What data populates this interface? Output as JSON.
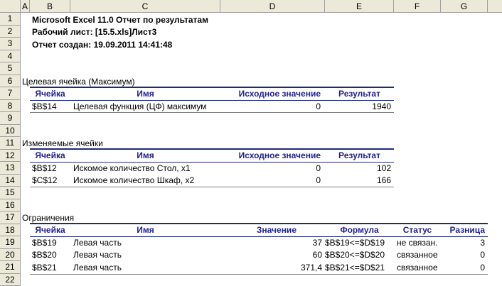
{
  "columns": [
    "A",
    "B",
    "C",
    "D",
    "E",
    "F",
    "G"
  ],
  "rows": [
    "1",
    "2",
    "3",
    "4",
    "5",
    "6",
    "7",
    "8",
    "9",
    "10",
    "11",
    "12",
    "13",
    "14",
    "15",
    "16",
    "17",
    "18",
    "19",
    "20",
    "21",
    "22"
  ],
  "report": {
    "title": "Microsoft Excel 11.0 Отчет по результатам",
    "worksheet": "Рабочий лист: [15.5.xls]Лист3",
    "created": "Отчет создан: 19.09.2011 14:41:48"
  },
  "target": {
    "section": "Целевая ячейка (Максимум)",
    "headers": [
      "Ячейка",
      "Имя",
      "Исходное значение",
      "Результат"
    ],
    "rows": [
      {
        "cell": "$B$14",
        "name": "Целевая функция (ЦФ) максимум",
        "initial": "0",
        "result": "1940"
      }
    ]
  },
  "variables": {
    "section": "Изменяемые ячейки",
    "headers": [
      "Ячейка",
      "Имя",
      "Исходное значение",
      "Результат"
    ],
    "rows": [
      {
        "cell": "$B$12",
        "name": "Искомое количество Стол, х1",
        "initial": "0",
        "result": "102"
      },
      {
        "cell": "$C$12",
        "name": "Искомое количество Шкаф, х2",
        "initial": "0",
        "result": "166"
      }
    ]
  },
  "constraints": {
    "section": "Ограничения",
    "headers": [
      "Ячейка",
      "Имя",
      "Значение",
      "Формула",
      "Статус",
      "Разница"
    ],
    "rows": [
      {
        "cell": "$B$19",
        "name": "Левая часть",
        "value": "37",
        "formula": "$B$19<=$D$19",
        "status": "не связан.",
        "diff": "3"
      },
      {
        "cell": "$B$20",
        "name": "Левая часть",
        "value": "60",
        "formula": "$B$20<=$D$20",
        "status": "связанное",
        "diff": "0"
      },
      {
        "cell": "$B$21",
        "name": "Левая часть",
        "value": "371,4",
        "formula": "$B$21<=$D$21",
        "status": "связанное",
        "diff": "0"
      }
    ]
  }
}
